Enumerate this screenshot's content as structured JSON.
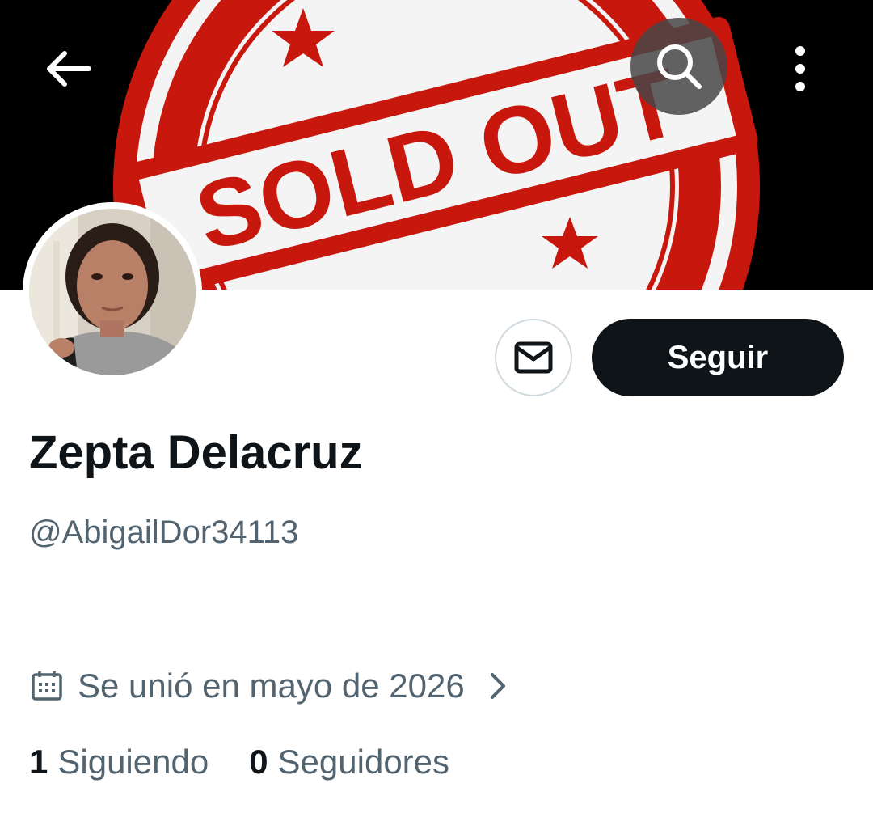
{
  "header": {
    "banner_text": "SOLD OUT",
    "icons": {
      "back": "arrow-left-icon",
      "search": "search-icon",
      "more": "more-vertical-icon"
    }
  },
  "profile": {
    "display_name": "Zepta Delacruz",
    "handle": "@AbigailDor34113",
    "joined": "Se unió en mayo de 2026",
    "follow_label": "Seguir",
    "following_count": "1",
    "following_label": "Siguiendo",
    "followers_count": "0",
    "followers_label": "Seguidores"
  },
  "colors": {
    "follow_button_bg": "#0f1419",
    "secondary_text": "#536471",
    "banner_red": "#c8180e",
    "banner_bg": "#000000"
  }
}
